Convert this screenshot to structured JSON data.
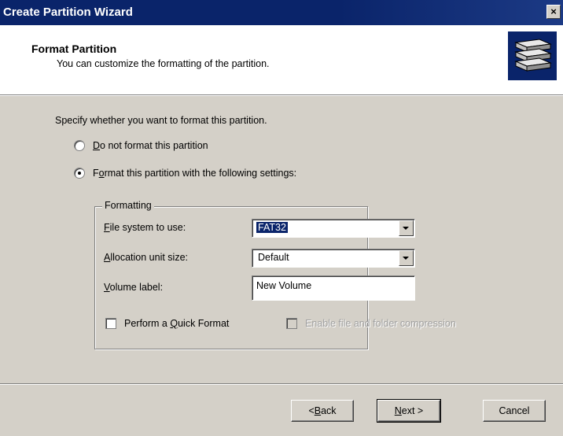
{
  "window": {
    "title": "Create Partition Wizard",
    "close_glyph": "×"
  },
  "header": {
    "title": "Format Partition",
    "subtitle": "You can customize the formatting of the partition.",
    "icon": "disk-stack-icon"
  },
  "prompt": "Specify whether you want to format this partition.",
  "options": {
    "do_not_format": {
      "accel": "D",
      "rest": "o not format this partition",
      "selected": false
    },
    "format": {
      "pre": "F",
      "accel": "o",
      "rest": "rmat this partition with the following settings:",
      "selected": true
    }
  },
  "formatting": {
    "group_label": "Formatting",
    "file_system": {
      "accel": "F",
      "rest": "ile system to use:",
      "value": "FAT32"
    },
    "allocation": {
      "accel": "A",
      "rest": "llocation unit size:",
      "value": "Default"
    },
    "volume": {
      "accel": "V",
      "rest": "olume label:",
      "value": "New Volume"
    },
    "quick_format": {
      "pre": "Perform a ",
      "accel": "Q",
      "rest": "uick Format",
      "checked": false
    },
    "compression": {
      "label": "Enable file and folder compression",
      "checked": false,
      "enabled": false
    }
  },
  "buttons": {
    "back": {
      "pre": "< ",
      "accel": "B",
      "rest": "ack"
    },
    "next": {
      "accel": "N",
      "rest": "ext >"
    },
    "cancel": "Cancel"
  },
  "colors": {
    "titlebar": "#0a246a",
    "face": "#d4d0c8",
    "selection": "#0a246a"
  }
}
